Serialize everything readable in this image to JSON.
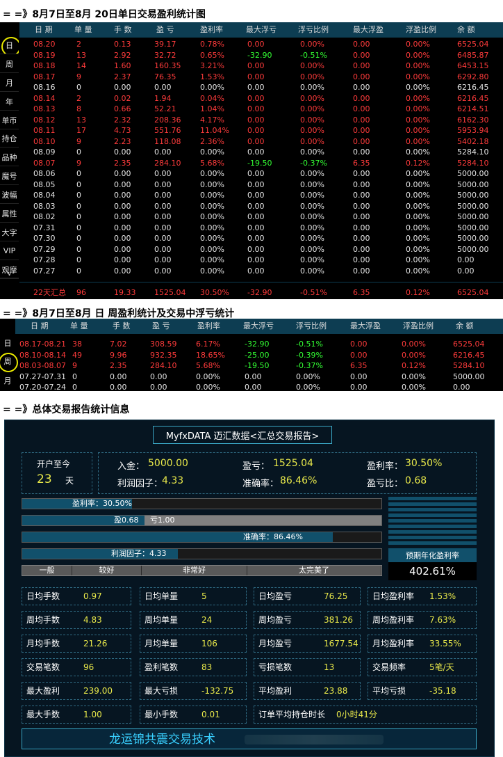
{
  "section1_title": "= =》8月7日至8月 20日单日交易盈利统计图",
  "section2_title": "= =》8月7日至8月   日    周盈利统计及交易中浮亏统计",
  "section3_title": "= =》总体交易报告统计信息",
  "nav_items": [
    "日",
    "周",
    "月",
    "年",
    "单币",
    "持仓",
    "品种",
    "魔号",
    "波幅",
    "属性",
    "大字",
    "VIP",
    "观摩",
    "∨"
  ],
  "columns": [
    "日 期",
    "单 量",
    "手 数",
    "盈 亏",
    "盈利率",
    "最大浮亏",
    "浮亏比例",
    "最大浮盈",
    "浮盈比例",
    "余 额"
  ],
  "daily_rows": [
    {
      "date": "08.20",
      "orders": "2",
      "lots": "0.13",
      "pl": "39.17",
      "rate": "0.78%",
      "maxloss": "0.00",
      "lossratio": "0.00%",
      "maxgain": "0.00",
      "gainratio": "0.00%",
      "balance": "6525.04",
      "color": "red"
    },
    {
      "date": "08.19",
      "orders": "13",
      "lots": "2.92",
      "pl": "32.72",
      "rate": "0.65%",
      "maxloss": "-32.90",
      "lossratio": "-0.51%",
      "maxgain": "0.00",
      "gainratio": "0.00%",
      "balance": "6485.87",
      "color": "red"
    },
    {
      "date": "08.18",
      "orders": "14",
      "lots": "1.60",
      "pl": "160.35",
      "rate": "3.21%",
      "maxloss": "0.00",
      "lossratio": "0.00%",
      "maxgain": "0.00",
      "gainratio": "0.00%",
      "balance": "6453.15",
      "color": "red"
    },
    {
      "date": "08.17",
      "orders": "9",
      "lots": "2.37",
      "pl": "76.35",
      "rate": "1.53%",
      "maxloss": "0.00",
      "lossratio": "0.00%",
      "maxgain": "0.00",
      "gainratio": "0.00%",
      "balance": "6292.80",
      "color": "red"
    },
    {
      "date": "08.16",
      "orders": "0",
      "lots": "0.00",
      "pl": "0.00",
      "rate": "0.00%",
      "maxloss": "0.00",
      "lossratio": "0.00%",
      "maxgain": "0.00",
      "gainratio": "0.00%",
      "balance": "6216.45",
      "color": "white"
    },
    {
      "date": "08.14",
      "orders": "2",
      "lots": "0.02",
      "pl": "1.94",
      "rate": "0.04%",
      "maxloss": "0.00",
      "lossratio": "0.00%",
      "maxgain": "0.00",
      "gainratio": "0.00%",
      "balance": "6216.45",
      "color": "red"
    },
    {
      "date": "08.13",
      "orders": "8",
      "lots": "0.66",
      "pl": "52.21",
      "rate": "1.04%",
      "maxloss": "0.00",
      "lossratio": "0.00%",
      "maxgain": "0.00",
      "gainratio": "0.00%",
      "balance": "6214.51",
      "color": "red"
    },
    {
      "date": "08.12",
      "orders": "13",
      "lots": "2.32",
      "pl": "208.36",
      "rate": "4.17%",
      "maxloss": "0.00",
      "lossratio": "0.00%",
      "maxgain": "0.00",
      "gainratio": "0.00%",
      "balance": "6162.30",
      "color": "red"
    },
    {
      "date": "08.11",
      "orders": "17",
      "lots": "4.73",
      "pl": "551.76",
      "rate": "11.04%",
      "maxloss": "0.00",
      "lossratio": "0.00%",
      "maxgain": "0.00",
      "gainratio": "0.00%",
      "balance": "5953.94",
      "color": "red"
    },
    {
      "date": "08.10",
      "orders": "9",
      "lots": "2.23",
      "pl": "118.08",
      "rate": "2.36%",
      "maxloss": "0.00",
      "lossratio": "0.00%",
      "maxgain": "0.00",
      "gainratio": "0.00%",
      "balance": "5402.18",
      "color": "red"
    },
    {
      "date": "08.09",
      "orders": "0",
      "lots": "0.00",
      "pl": "0.00",
      "rate": "0.00%",
      "maxloss": "0.00",
      "lossratio": "0.00%",
      "maxgain": "0.00",
      "gainratio": "0.00%",
      "balance": "5284.10",
      "color": "white"
    },
    {
      "date": "08.07",
      "orders": "9",
      "lots": "2.35",
      "pl": "284.10",
      "rate": "5.68%",
      "maxloss": "-19.50",
      "lossratio": "-0.37%",
      "maxgain": "6.35",
      "gainratio": "0.12%",
      "balance": "5284.10",
      "color": "red"
    },
    {
      "date": "08.06",
      "orders": "0",
      "lots": "0.00",
      "pl": "0.00",
      "rate": "0.00%",
      "maxloss": "0.00",
      "lossratio": "0.00%",
      "maxgain": "0.00",
      "gainratio": "0.00%",
      "balance": "5000.00",
      "color": "white"
    },
    {
      "date": "08.05",
      "orders": "0",
      "lots": "0.00",
      "pl": "0.00",
      "rate": "0.00%",
      "maxloss": "0.00",
      "lossratio": "0.00%",
      "maxgain": "0.00",
      "gainratio": "0.00%",
      "balance": "5000.00",
      "color": "white"
    },
    {
      "date": "08.04",
      "orders": "0",
      "lots": "0.00",
      "pl": "0.00",
      "rate": "0.00%",
      "maxloss": "0.00",
      "lossratio": "0.00%",
      "maxgain": "0.00",
      "gainratio": "0.00%",
      "balance": "5000.00",
      "color": "white"
    },
    {
      "date": "08.03",
      "orders": "0",
      "lots": "0.00",
      "pl": "0.00",
      "rate": "0.00%",
      "maxloss": "0.00",
      "lossratio": "0.00%",
      "maxgain": "0.00",
      "gainratio": "0.00%",
      "balance": "5000.00",
      "color": "white"
    },
    {
      "date": "08.02",
      "orders": "0",
      "lots": "0.00",
      "pl": "0.00",
      "rate": "0.00%",
      "maxloss": "0.00",
      "lossratio": "0.00%",
      "maxgain": "0.00",
      "gainratio": "0.00%",
      "balance": "5000.00",
      "color": "white"
    },
    {
      "date": "07.31",
      "orders": "0",
      "lots": "0.00",
      "pl": "0.00",
      "rate": "0.00%",
      "maxloss": "0.00",
      "lossratio": "0.00%",
      "maxgain": "0.00",
      "gainratio": "0.00%",
      "balance": "5000.00",
      "color": "white"
    },
    {
      "date": "07.30",
      "orders": "0",
      "lots": "0.00",
      "pl": "0.00",
      "rate": "0.00%",
      "maxloss": "0.00",
      "lossratio": "0.00%",
      "maxgain": "0.00",
      "gainratio": "0.00%",
      "balance": "5000.00",
      "color": "white"
    },
    {
      "date": "07.29",
      "orders": "0",
      "lots": "0.00",
      "pl": "0.00",
      "rate": "0.00%",
      "maxloss": "0.00",
      "lossratio": "0.00%",
      "maxgain": "0.00",
      "gainratio": "0.00%",
      "balance": "5000.00",
      "color": "white"
    },
    {
      "date": "07.28",
      "orders": "0",
      "lots": "0.00",
      "pl": "0.00",
      "rate": "0.00%",
      "maxloss": "0.00",
      "lossratio": "0.00%",
      "maxgain": "0.00",
      "gainratio": "0.00%",
      "balance": "0.00",
      "color": "white"
    },
    {
      "date": "07.27",
      "orders": "0",
      "lots": "0.00",
      "pl": "0.00",
      "rate": "0.00%",
      "maxloss": "0.00",
      "lossratio": "0.00%",
      "maxgain": "0.00",
      "gainratio": "0.00%",
      "balance": "0.00",
      "color": "white"
    }
  ],
  "daily_summary": {
    "date": "22天汇总",
    "orders": "96",
    "lots": "19.33",
    "pl": "1525.04",
    "rate": "30.50%",
    "maxloss": "-32.90",
    "lossratio": "-0.51%",
    "maxgain": "6.35",
    "gainratio": "0.12%",
    "balance": "6525.04"
  },
  "weekly_nav": [
    "日",
    "周",
    "月"
  ],
  "weekly_rows": [
    {
      "date": "08.17-08.21",
      "orders": "38",
      "lots": "7.02",
      "pl": "308.59",
      "rate": "6.17%",
      "maxloss": "-32.90",
      "lossratio": "-0.51%",
      "maxgain": "0.00",
      "gainratio": "0.00%",
      "balance": "6525.04",
      "color": "red"
    },
    {
      "date": "08.10-08.14",
      "orders": "49",
      "lots": "9.96",
      "pl": "932.35",
      "rate": "18.65%",
      "maxloss": "-25.00",
      "lossratio": "-0.39%",
      "maxgain": "0.00",
      "gainratio": "0.00%",
      "balance": "6216.45",
      "color": "red"
    },
    {
      "date": "08.03-08.07",
      "orders": "9",
      "lots": "2.35",
      "pl": "284.10",
      "rate": "5.68%",
      "maxloss": "-19.50",
      "lossratio": "-0.37%",
      "maxgain": "6.35",
      "gainratio": "0.12%",
      "balance": "5284.10",
      "color": "red"
    },
    {
      "date": "07.27-07.31",
      "orders": "0",
      "lots": "0.00",
      "pl": "0.00",
      "rate": "0.00%",
      "maxloss": "0.00",
      "lossratio": "0.00%",
      "maxgain": "0.00",
      "gainratio": "0.00%",
      "balance": "5000.00",
      "color": "white"
    },
    {
      "date": "07.20-07.24",
      "orders": "0",
      "lots": "0.00",
      "pl": "0.00",
      "rate": "0.00%",
      "maxloss": "0.00",
      "lossratio": "0.00%",
      "maxgain": "0.00",
      "gainratio": "0.00%",
      "balance": "0.00",
      "color": "white"
    }
  ],
  "report": {
    "title": "MyfxDATA 迈汇数据<汇总交易报告>",
    "since_label": "开户至今",
    "since_days": "23",
    "since_unit": "天",
    "deposit_label": "入金：",
    "deposit_value": "5000.00",
    "pl_label": "盈亏：",
    "pl_value": "1525.04",
    "rate_label": "盈利率：",
    "rate_value": "30.50%",
    "pf_label": "利润因子：",
    "pf_value": "4.33",
    "acc_label": "准确率：",
    "acc_value": "86.46%",
    "ratio_label": "盈亏比：",
    "ratio_value": "0.68",
    "bar1_text": "盈利率：30.50%",
    "bar1_fill": 0.305,
    "bar2_win": "盈0.68",
    "bar2_loss": "亏1.00",
    "bar2_fill": 0.34,
    "bar3_text": "准确率：86.46%",
    "bar3_fill": 0.8646,
    "bar4_text": "利润因子：4.33",
    "bar4_fill": 0.433,
    "grades": [
      "一般",
      "较好",
      "非常好",
      "太完美了"
    ],
    "annual_label": "预期年化盈利率",
    "annual_value": "402.61%",
    "stats": [
      [
        {
          "l": "日均手数",
          "v": "0.97"
        },
        {
          "l": "日均单量",
          "v": "5"
        },
        {
          "l": "日均盈亏",
          "v": "76.25"
        },
        {
          "l": "日均盈利率",
          "v": "1.53%"
        }
      ],
      [
        {
          "l": "周均手数",
          "v": "4.83"
        },
        {
          "l": "周均单量",
          "v": "24"
        },
        {
          "l": "周均盈亏",
          "v": "381.26"
        },
        {
          "l": "周均盈利率",
          "v": "7.63%"
        }
      ],
      [
        {
          "l": "月均手数",
          "v": "21.26"
        },
        {
          "l": "月均单量",
          "v": "106"
        },
        {
          "l": "月均盈亏",
          "v": "1677.54"
        },
        {
          "l": "月均盈利率",
          "v": "33.55%"
        }
      ],
      [
        {
          "l": "交易笔数",
          "v": "96"
        },
        {
          "l": "盈利笔数",
          "v": "83"
        },
        {
          "l": "亏损笔数",
          "v": "13"
        },
        {
          "l": "交易频率",
          "v": "5笔/天"
        }
      ],
      [
        {
          "l": "最大盈利",
          "v": "239.00"
        },
        {
          "l": "最大亏损",
          "v": "-132.75"
        },
        {
          "l": "平均盈利",
          "v": "23.88"
        },
        {
          "l": "平均亏损",
          "v": "-35.18"
        }
      ]
    ],
    "last_stats": [
      {
        "l": "最大手数",
        "v": "1.00"
      },
      {
        "l": "最小手数",
        "v": "0.01"
      }
    ],
    "hold_label": "订单平均持仓时长",
    "hold_value": "0小时41分",
    "brand": "龙运锦共震交易技术"
  }
}
